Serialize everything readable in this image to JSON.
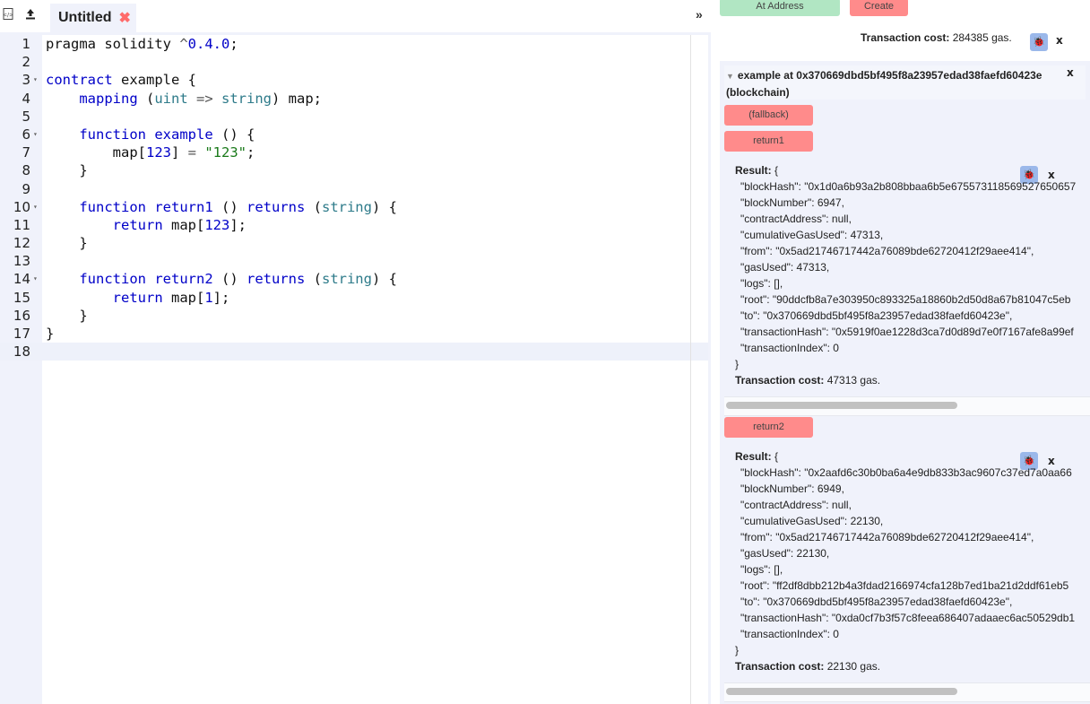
{
  "editor": {
    "tab_label": "Untitled",
    "tab_close_icon": "✖",
    "toolbar_icons": [
      "file-code-icon",
      "upload-icon"
    ],
    "toggle_panel_icon": "»",
    "lines": [
      {
        "n": "1",
        "fold": "",
        "html": "pragma solidity <span class=\"op\">^</span><span class=\"num\">0.4.0</span>;"
      },
      {
        "n": "2",
        "fold": "",
        "html": ""
      },
      {
        "n": "3",
        "fold": "▾",
        "html": "<span class=\"kw\">contract</span> example {"
      },
      {
        "n": "4",
        "fold": "",
        "html": "    <span class=\"kw\">mapping</span> (<span class=\"ty\">uint</span> <span class=\"op\">=&gt;</span> <span class=\"ty\">string</span>) map;"
      },
      {
        "n": "5",
        "fold": "",
        "html": ""
      },
      {
        "n": "6",
        "fold": "▾",
        "html": "    <span class=\"kw\">function</span> <span class=\"kw\">example</span> () {"
      },
      {
        "n": "7",
        "fold": "",
        "html": "        map[<span class=\"num\">123</span>] <span class=\"op\">=</span> <span class=\"str\">\"123\"</span>;"
      },
      {
        "n": "8",
        "fold": "",
        "html": "    }"
      },
      {
        "n": "9",
        "fold": "",
        "html": ""
      },
      {
        "n": "10",
        "fold": "▾",
        "html": "    <span class=\"kw\">function</span> <span class=\"kw\">return1</span> () <span class=\"kw\">returns</span> (<span class=\"ty\">string</span>) {"
      },
      {
        "n": "11",
        "fold": "",
        "html": "        <span class=\"kw\">return</span> map[<span class=\"num\">123</span>];"
      },
      {
        "n": "12",
        "fold": "",
        "html": "    }"
      },
      {
        "n": "13",
        "fold": "",
        "html": ""
      },
      {
        "n": "14",
        "fold": "▾",
        "html": "    <span class=\"kw\">function</span> <span class=\"kw\">return2</span> () <span class=\"kw\">returns</span> (<span class=\"ty\">string</span>) {"
      },
      {
        "n": "15",
        "fold": "",
        "html": "        <span class=\"kw\">return</span> map[<span class=\"num\">1</span>];"
      },
      {
        "n": "16",
        "fold": "",
        "html": "    }"
      },
      {
        "n": "17",
        "fold": "",
        "html": "}"
      },
      {
        "n": "18",
        "fold": "",
        "html": "",
        "active": true
      }
    ]
  },
  "run_panel": {
    "at_address_label": "At Address",
    "create_label": "Create",
    "deploy_cost_label": "Transaction cost:",
    "deploy_cost_value": " 284385 gas.",
    "debug_icon": "🐞",
    "close_label": "x",
    "instance": {
      "header": "example at 0x370669dbd5bf495f8a23957edad38faefd60423e (blockchain)",
      "caret": "▼",
      "close_label": "x",
      "buttons": {
        "fallback": "(fallback)",
        "return1": "return1",
        "return2": "return2"
      }
    },
    "results": [
      {
        "title": "Result:",
        "open": " {",
        "lines": [
          "\"blockHash\": \"0x1d0a6b93a2b808bbaa6b5e675573118569527650657",
          "\"blockNumber\": 6947,",
          "\"contractAddress\": null,",
          "\"cumulativeGasUsed\": 47313,",
          "\"from\": \"0x5ad21746717442a76089bde62720412f29aee414\",",
          "\"gasUsed\": 47313,",
          "\"logs\": [],",
          "\"root\": \"90ddcfb8a7e303950c893325a18860b2d50d8a67b81047c5eb",
          "\"to\": \"0x370669dbd5bf495f8a23957edad38faefd60423e\",",
          "\"transactionHash\": \"0x5919f0ae1228d3ca7d0d89d7e0f7167afe8a99ef",
          "\"transactionIndex\": 0"
        ],
        "close": "}",
        "cost_label": "Transaction cost:",
        "cost_value": " 47313 gas."
      },
      {
        "title": "Result:",
        "open": " {",
        "lines": [
          "\"blockHash\": \"0x2aafd6c30b0ba6a4e9db833b3ac9607c37ed7a0aa66",
          "\"blockNumber\": 6949,",
          "\"contractAddress\": null,",
          "\"cumulativeGasUsed\": 22130,",
          "\"from\": \"0x5ad21746717442a76089bde62720412f29aee414\",",
          "\"gasUsed\": 22130,",
          "\"logs\": [],",
          "\"root\": \"ff2df8dbb212b4a3fdad2166974cfa128b7ed1ba21d2ddf61eb5",
          "\"to\": \"0x370669dbd5bf495f8a23957edad38faefd60423e\",",
          "\"transactionHash\": \"0xda0cf7b3f57c8feea686407adaaec6ac50529db1",
          "\"transactionIndex\": 0"
        ],
        "close": "}",
        "cost_label": "Transaction cost:",
        "cost_value": " 22130 gas."
      }
    ]
  }
}
